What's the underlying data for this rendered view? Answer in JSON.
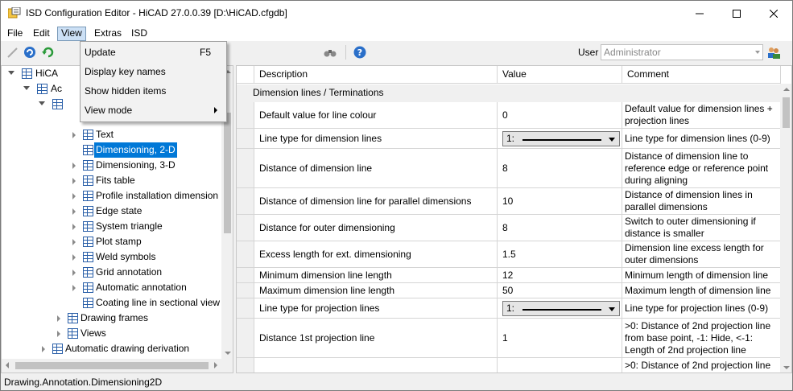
{
  "window": {
    "title": "ISD Configuration Editor  - HiCAD 27.0.0.39 [D:\\HiCAD.cfgdb]"
  },
  "menubar": [
    "File",
    "Edit",
    "View",
    "Extras",
    "ISD"
  ],
  "view_menu": [
    {
      "label": "Update",
      "shortcut": "F5"
    },
    {
      "label": "Display key names",
      "shortcut": ""
    },
    {
      "label": "Show hidden items",
      "shortcut": ""
    },
    {
      "label": "View mode",
      "shortcut": ""
    }
  ],
  "toolbar": {
    "user_label": "User",
    "user_value": "Administrator"
  },
  "tree": {
    "items": [
      {
        "label": "HiCA",
        "level": 0
      },
      {
        "label": "Ac",
        "level": 1
      },
      {
        "label": "",
        "level": 2
      },
      {
        "label": "Text",
        "level": 4
      },
      {
        "label": "Dimensioning, 2-D",
        "level": 4,
        "selected": true
      },
      {
        "label": "Dimensioning, 3-D",
        "level": 4
      },
      {
        "label": "Fits table",
        "level": 4
      },
      {
        "label": "Profile installation dimension",
        "level": 4
      },
      {
        "label": "Edge state",
        "level": 4
      },
      {
        "label": "System triangle",
        "level": 4
      },
      {
        "label": "Plot stamp",
        "level": 4
      },
      {
        "label": "Weld symbols",
        "level": 4
      },
      {
        "label": "Grid annotation",
        "level": 4
      },
      {
        "label": "Automatic annotation",
        "level": 4
      },
      {
        "label": "Coating line in sectional view",
        "level": 4
      },
      {
        "label": "Drawing frames",
        "level": 3
      },
      {
        "label": "Views",
        "level": 3
      },
      {
        "label": "Automatic drawing derivation",
        "level": 2
      }
    ]
  },
  "grid": {
    "columns": [
      "Description",
      "Value",
      "Comment"
    ],
    "section": "Dimension lines / Terminations",
    "rows": [
      {
        "description": "Default value for line colour",
        "value": "0",
        "comment": "Default value for dimension lines + projection lines"
      },
      {
        "description": "Line type for dimension lines",
        "value": "1:",
        "comment": "Line type for dimension lines (0-9)"
      },
      {
        "description": "Distance of dimension line",
        "value": "8",
        "comment": "Distance of dimension line to reference edge or reference point during aligning"
      },
      {
        "description": "Distance of dimension line for parallel dimensions",
        "value": "10",
        "comment": "Distance of dimension lines in parallel dimensions"
      },
      {
        "description": "Distance for outer dimensioning",
        "value": "8",
        "comment": "Switch to outer dimensioning if distance is smaller"
      },
      {
        "description": "Excess length for ext. dimensioning",
        "value": "1.5",
        "comment": "Dimension line excess length for outer dimensions"
      },
      {
        "description": "Minimum dimension line length",
        "value": "12",
        "comment": "Minimum length of dimension line"
      },
      {
        "description": "Maximum dimension line length",
        "value": "50",
        "comment": "Maximum length of dimension line"
      },
      {
        "description": "Line type for projection lines",
        "value": "1:",
        "comment": "Line type for projection lines (0-9)"
      },
      {
        "description": "Distance 1st projection line",
        "value": "1",
        "comment": ">0: Distance of 2nd projection line from base point, -1: Hide, <-1: Length of 2nd projection line"
      },
      {
        "description": "",
        "value": "",
        "comment": ">0: Distance of 2nd projection line"
      }
    ]
  },
  "statusbar": {
    "text": "Drawing.Annotation.Dimensioning2D"
  }
}
